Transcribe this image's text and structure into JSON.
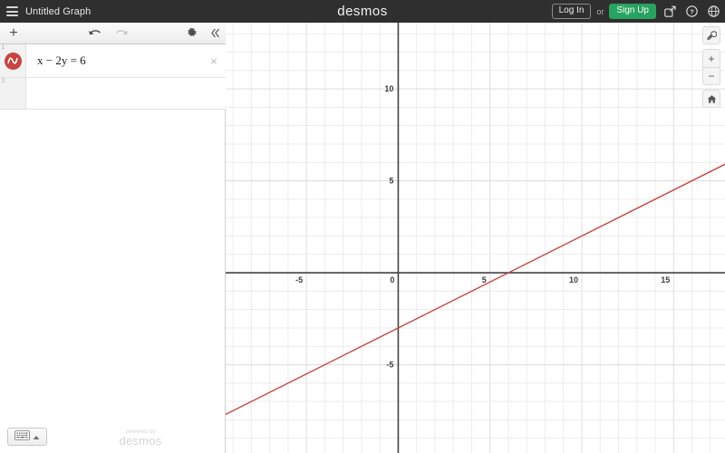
{
  "header": {
    "menu_icon": "hamburger-menu-icon",
    "title": "Untitled Graph",
    "brand": "desmos",
    "login_label": "Log In",
    "or_label": "or",
    "signup_label": "Sign Up",
    "share_icon": "share-icon",
    "help_icon": "help-question-icon",
    "language_icon": "globe-icon",
    "signup_color": "#27a361",
    "bar_color": "#2f2f2f"
  },
  "panel": {
    "add_label": "+",
    "undo_icon": "undo-arrow-icon",
    "redo_icon": "redo-arrow-icon",
    "settings_icon": "gear-icon",
    "collapse_icon": "double-chevron-left-icon",
    "expressions": [
      {
        "index": "1",
        "text": "x − 2y = 6",
        "color": "#c74440",
        "close_label": "×",
        "icon": "expression-curve-icon"
      },
      {
        "index": "2",
        "text": "",
        "color": "",
        "close_label": "",
        "icon": ""
      }
    ],
    "keyboard_icon": "keyboard-icon",
    "keyboard_caret_icon": "caret-up-icon",
    "watermark_small": "powered by",
    "watermark_big": "desmos"
  },
  "graph_controls": {
    "wrench_icon": "wrench-icon",
    "zoom_in_label": "+",
    "zoom_out_label": "−",
    "home_icon": "home-icon"
  },
  "chart_data": {
    "type": "line",
    "title": "",
    "xlabel": "",
    "ylabel": "",
    "equation": "x - 2y = 6",
    "slope": 0.5,
    "y_intercept": -3,
    "x_intercept": 6,
    "line_color": "#c74440",
    "grid": true,
    "minor_grid_step": 1,
    "major_grid_step": 5,
    "xlim": [
      -9.4,
      17.8
    ],
    "ylim": [
      -9.8,
      13.6
    ],
    "x_ticks": [
      -5,
      0,
      5,
      10,
      15
    ],
    "y_ticks": [
      -5,
      5,
      10
    ],
    "x_tick_labels": [
      "-5",
      "0",
      "5",
      "10",
      "15"
    ],
    "y_tick_labels": [
      "-5",
      "5",
      "10"
    ],
    "axis_color": "#444444",
    "minor_grid_color": "#ececec",
    "major_grid_color": "#dcdcdc",
    "series": [
      {
        "name": "x - 2y = 6",
        "x": [
          -9.4,
          17.8
        ],
        "y": [
          -7.7,
          5.9
        ]
      }
    ]
  }
}
